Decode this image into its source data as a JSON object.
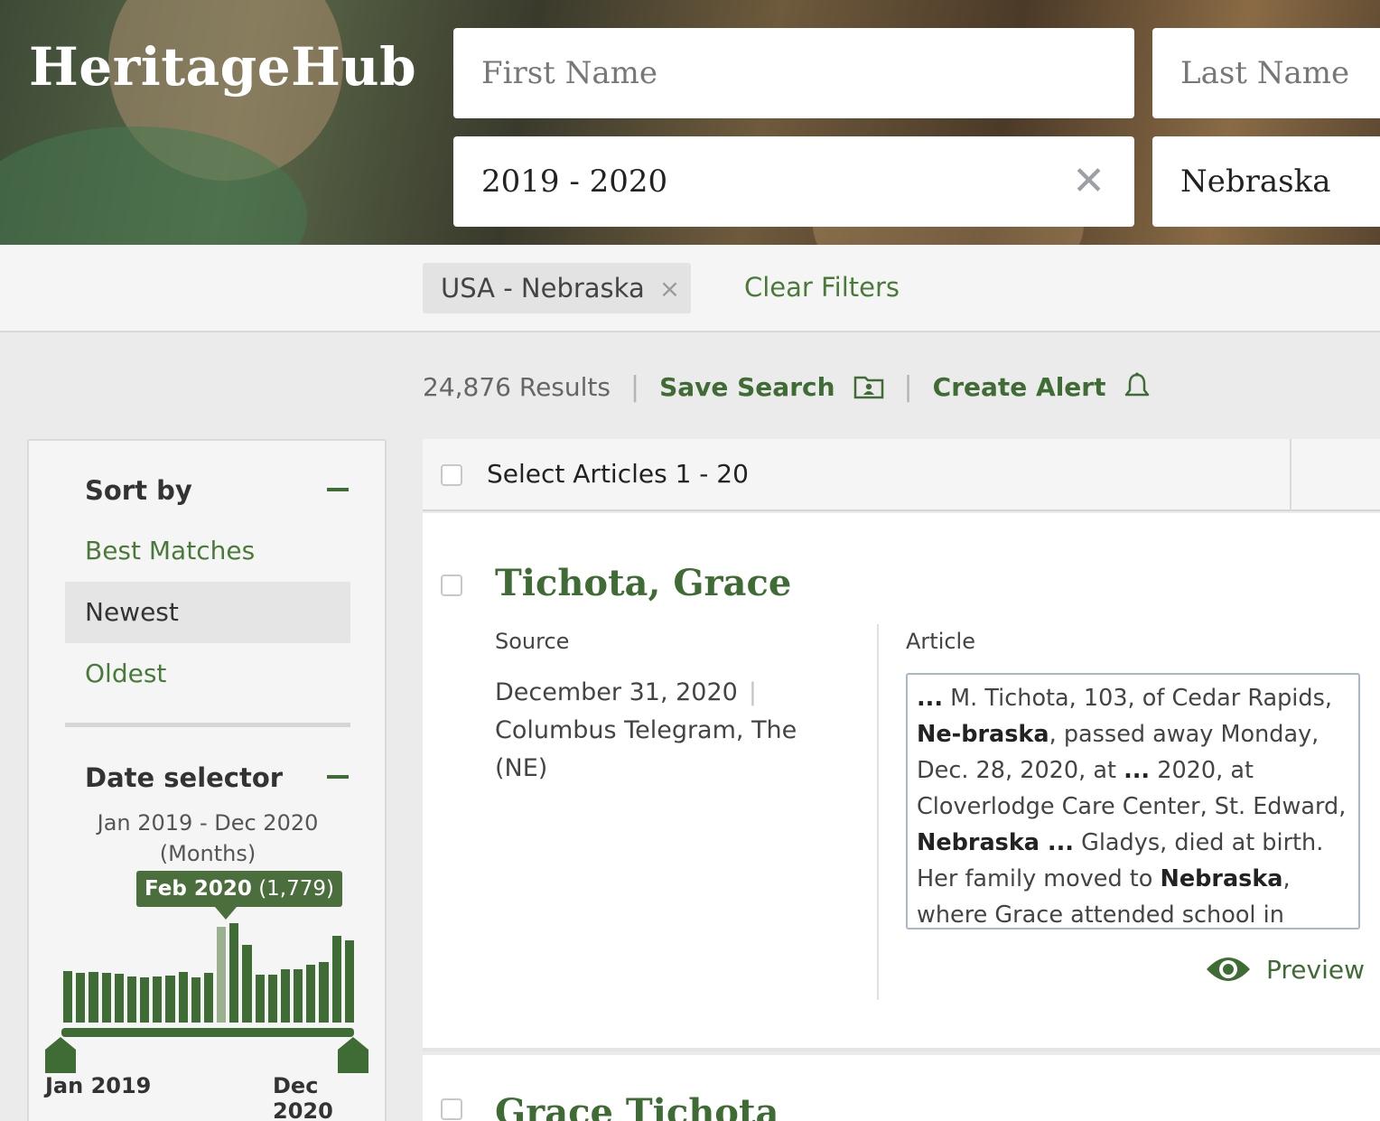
{
  "header": {
    "logo": "HeritageHub",
    "first_name_placeholder": "First Name",
    "last_name_placeholder": "Last Name",
    "date_value": "2019 - 2020",
    "place_value": "Nebraska",
    "clear_icon": "close-icon"
  },
  "filters": {
    "chip_label": "USA - Nebraska",
    "chip_remove": "×",
    "clear_label": "Clear Filters"
  },
  "results": {
    "count": "24,876 Results",
    "separator": "|",
    "save_label": "Save Search",
    "alert_label": "Create Alert"
  },
  "sidebar": {
    "sort_heading": "Sort by",
    "sort_options": [
      "Best Matches",
      "Newest",
      "Oldest"
    ],
    "selected_sort": "Newest",
    "date_heading": "Date selector",
    "range_line1": "Jan 2019 - Dec 2020",
    "range_line2": "(Months)",
    "tooltip_month": "Feb 2020",
    "tooltip_count": "(1,779)",
    "axis_start": "Jan 2019",
    "axis_end": "Dec 2020",
    "histogram": [
      0.52,
      0.5,
      0.51,
      0.5,
      0.49,
      0.46,
      0.45,
      0.46,
      0.47,
      0.51,
      0.45,
      0.5,
      0.96,
      1.0,
      0.78,
      0.48,
      0.48,
      0.54,
      0.54,
      0.58,
      0.61,
      0.87,
      0.83
    ],
    "histogram_selected_index": 13,
    "accent_color": "#3f6b34"
  },
  "main": {
    "select_label": "Select Articles 1 - 20",
    "result": {
      "title": "Tichota, Grace",
      "source_label": "Source",
      "article_label": "Article",
      "date": "December 31, 2020",
      "date_separator": "|",
      "publication": "Columbus Telegram, The (NE)",
      "preview_label": "Preview"
    },
    "next_title": "Grace Tichota"
  }
}
